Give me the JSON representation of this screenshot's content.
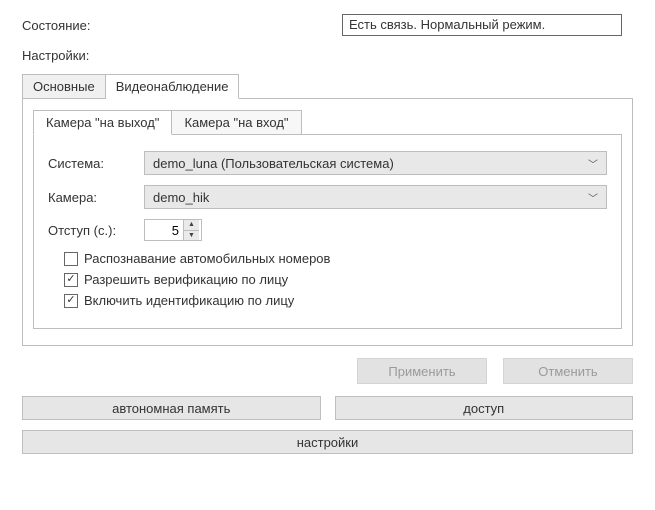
{
  "state": {
    "label": "Состояние:",
    "value": "Есть связь. Нормальный режим."
  },
  "settings_title": "Настройки:",
  "outer_tabs": {
    "basic": "Основные",
    "video": "Видеонаблюдение"
  },
  "inner_tabs": {
    "exit": "Камера \"на выход\"",
    "entry": "Камера \"на вход\""
  },
  "form": {
    "system_label": "Система:",
    "system_value": "demo_luna (Пользовательская система)",
    "camera_label": "Камера:",
    "camera_value": "demo_hik",
    "offset_label": "Отступ (с.):",
    "offset_value": "5"
  },
  "checks": {
    "plates": {
      "label": "Распознавание автомобильных номеров",
      "checked": false
    },
    "verify_face": {
      "label": "Разрешить верификацию по лицу",
      "checked": true
    },
    "identify_face": {
      "label": "Включить идентификацию по лицу",
      "checked": true
    }
  },
  "buttons": {
    "apply": "Применить",
    "cancel": "Отменить",
    "autonomous": "автономная память",
    "access": "доступ",
    "settings": "настройки"
  }
}
